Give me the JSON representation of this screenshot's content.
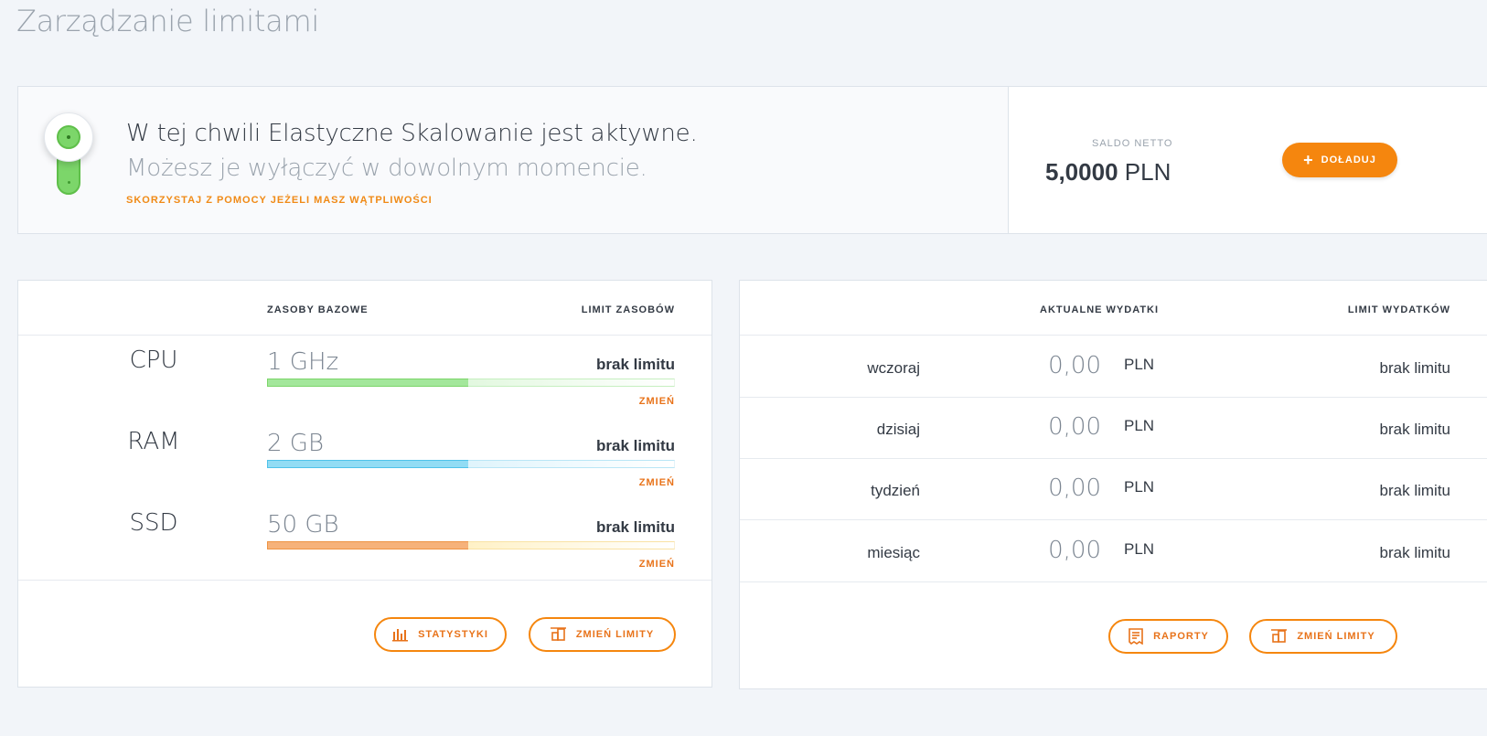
{
  "page": {
    "title": "Zarządzanie limitami"
  },
  "banner": {
    "toggle_on": true,
    "line1": "W tej chwili Elastyczne Skalowanie jest aktywne.",
    "line2": "Możesz je wyłączyć w dowolnym momencie.",
    "help": "SKORZYSTAJ Z POMOCY JEŻELI MASZ WĄTPLIWOŚCI",
    "saldo_label": "SALDO NETTO",
    "saldo_amount": "5,0000",
    "saldo_currency": "PLN",
    "topup_label": "DOŁADUJ"
  },
  "resources": {
    "col_base": "ZASOBY BAZOWE",
    "col_limit": "LIMIT ZASOBÓW",
    "rows": [
      {
        "name": "CPU",
        "value": "1 GHz",
        "limit": "brak limitu",
        "change": "ZMIEŃ",
        "color": "#7cd66a"
      },
      {
        "name": "RAM",
        "value": "2 GB",
        "limit": "brak limitu",
        "change": "ZMIEŃ",
        "color": "#4fc2ea"
      },
      {
        "name": "SSD",
        "value": "50 GB",
        "limit": "brak limitu",
        "change": "ZMIEŃ",
        "color": "#ee9444"
      }
    ],
    "btn_stats": "STATYSTYKI",
    "btn_change_limits": "ZMIEŃ LIMITY"
  },
  "spending": {
    "col_current": "AKTUALNE WYDATKI",
    "col_limit": "LIMIT WYDATKÓW",
    "rows": [
      {
        "period": "wczoraj",
        "amount": "0,00",
        "currency": "PLN",
        "limit": "brak limitu"
      },
      {
        "period": "dzisiaj",
        "amount": "0,00",
        "currency": "PLN",
        "limit": "brak limitu"
      },
      {
        "period": "tydzień",
        "amount": "0,00",
        "currency": "PLN",
        "limit": "brak limitu"
      },
      {
        "period": "miesiąc",
        "amount": "0,00",
        "currency": "PLN",
        "limit": "brak limitu"
      }
    ],
    "btn_reports": "RAPORTY",
    "btn_change_limits": "ZMIEŃ LIMITY"
  },
  "colors": {
    "accent": "#f5860e",
    "toggle": "#7cd66a"
  }
}
